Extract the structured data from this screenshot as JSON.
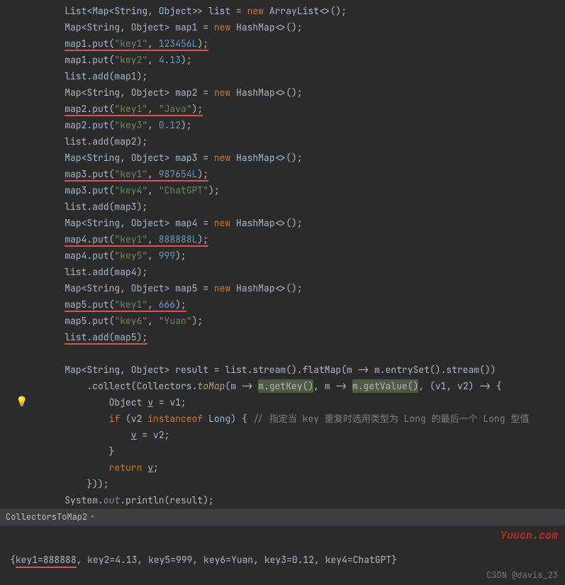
{
  "code": {
    "l1": "List<Map<String, Object>> list = new ArrayList<>();",
    "l2": "Map<String, Object> map1 = new HashMap<>();",
    "l3a": "map1.put(",
    "l3s": "\"key1\"",
    "l3v": "123456L",
    "l3e": ");",
    "l4a": "map1.put(",
    "l4s": "\"key2\"",
    "l4v": "4.13",
    "l4e": ");",
    "l5": "list.add(map1);",
    "l6": "Map<String, Object> map2 = new HashMap<>();",
    "l7a": "map2.put(",
    "l7s": "\"key1\"",
    "l7v": "\"Java\"",
    "l7e": ");",
    "l8a": "map2.put(",
    "l8s": "\"key3\"",
    "l8v": "0.12",
    "l8e": ");",
    "l9": "list.add(map2);",
    "l10": "Map<String, Object> map3 = new HashMap<>();",
    "l11a": "map3.put(",
    "l11s": "\"key1\"",
    "l11v": "987654L",
    "l11e": ");",
    "l12a": "map3.put(",
    "l12s": "\"key4\"",
    "l12v": "\"ChatGPT\"",
    "l12e": ");",
    "l13": "list.add(map3);",
    "l14": "Map<String, Object> map4 = new HashMap<>();",
    "l15a": "map4.put(",
    "l15s": "\"key1\"",
    "l15v": "888888L",
    "l15e": ");",
    "l16a": "map4.put(",
    "l16s": "\"key5\"",
    "l16v": "999",
    "l16e": ");",
    "l17": "list.add(map4);",
    "l18": "Map<String, Object> map5 = new HashMap<>();",
    "l19a": "map5.put(",
    "l19s": "\"key1\"",
    "l19v": "666",
    "l19e": ");",
    "l20a": "map5.put(",
    "l20s": "\"key6\"",
    "l20v": "\"Yuan\"",
    "l20e": ");",
    "l21": "list.add(map5);",
    "l23": "Map<String, Object> result = list.stream().flatMap(m -> m.entrySet().stream())",
    "l24a": "        .collect(Collectors.",
    "l24m": "toMap",
    "l24b": "(m -> ",
    "l24g1": "m.getKey()",
    "l24c": ", m -> ",
    "l24g2": "m.getValue()",
    "l24d": ", (v1, v2) -> {",
    "l25a": "            Object ",
    "l25v": "v",
    "l25b": " = v1;",
    "l26a": "            ",
    "l26kw": "if",
    "l26b": " (v2 ",
    "l26kw2": "instanceof",
    "l26c": " Long) { ",
    "l26cm": "// 指定当 key 重复时选用类型为 Long 的最后一个 Long 型值",
    "l27a": "                ",
    "l27v": "v",
    "l27b": " = v2;",
    "l28": "            }",
    "l29a": "            ",
    "l29kw": "return",
    "l29b": " ",
    "l29v": "v",
    "l29c": ";",
    "l30": "        }));",
    "l31a": "System.",
    "l31f": "out",
    "l31b": ".println(result);"
  },
  "tab": {
    "name": "CollectorsToMap2",
    "close": "×"
  },
  "console": {
    "key1": "key1=888888",
    "rest": ", key2=4.13, key5=999, key6=Yuan, key3=0.12, key4=ChatGPT}"
  },
  "watermark1": "Yuucn.com",
  "watermark2": "CSDN @davis_23"
}
